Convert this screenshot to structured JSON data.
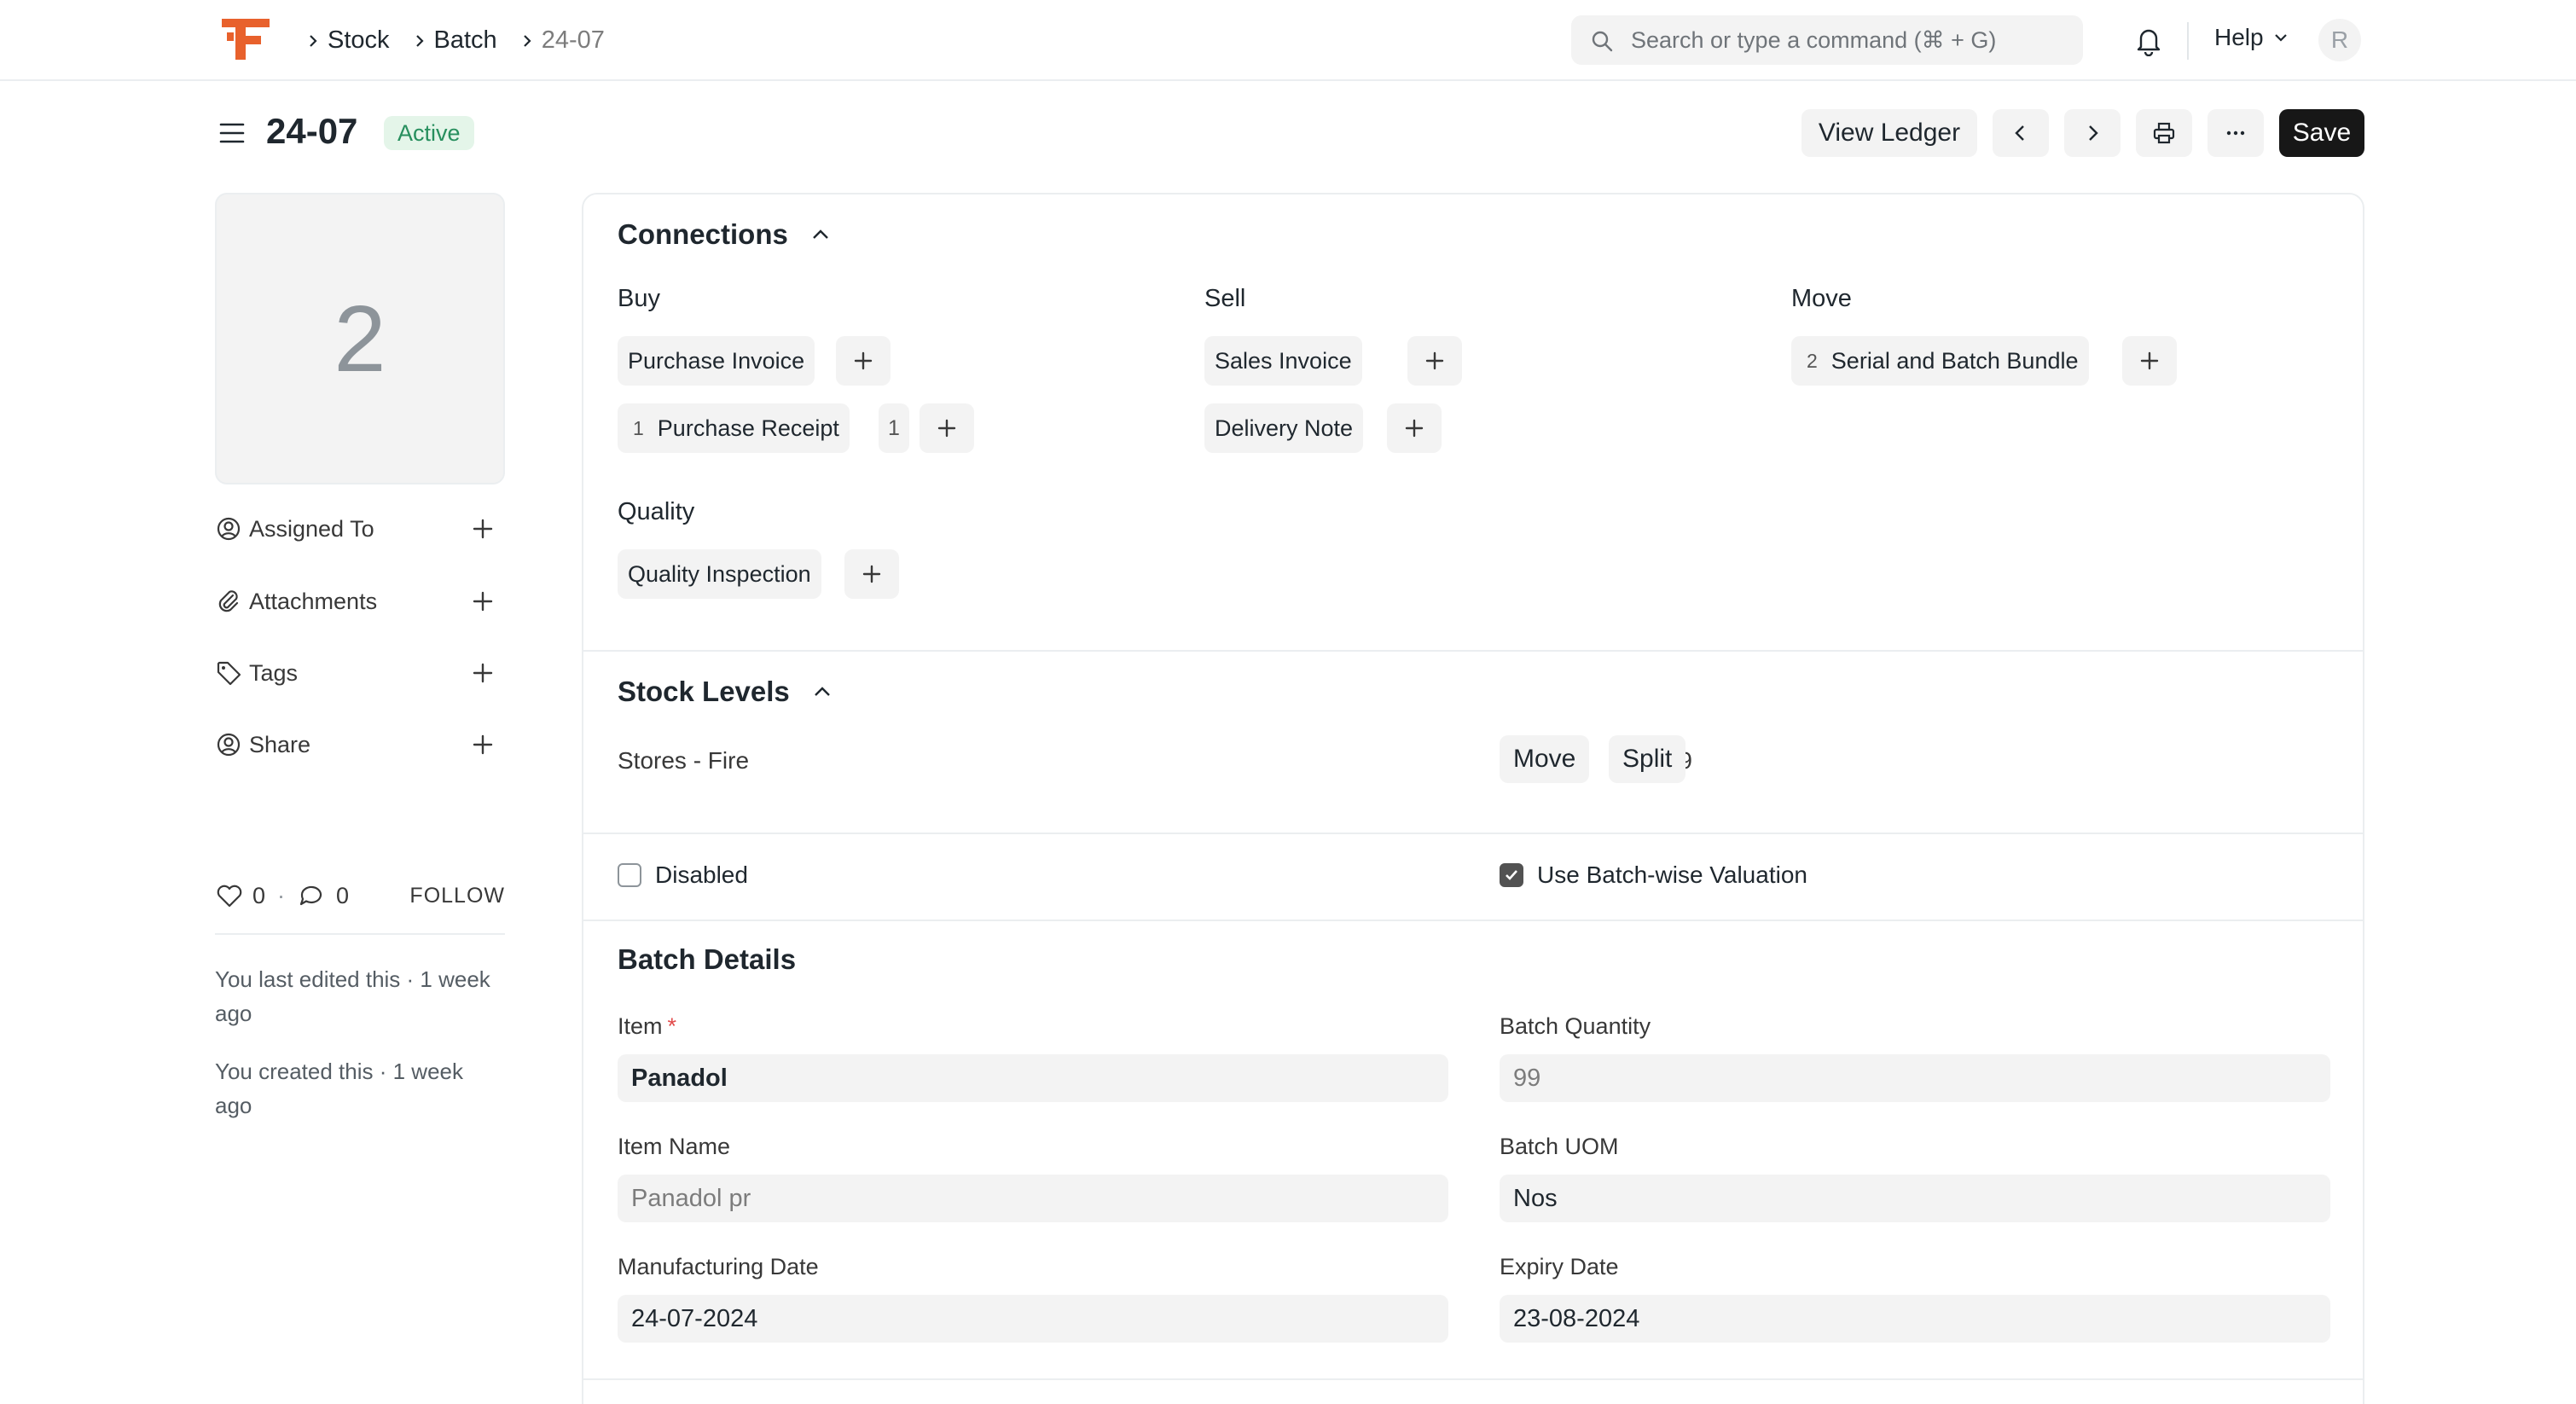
{
  "breadcrumb": {
    "items": [
      "Stock",
      "Batch",
      "24-07"
    ]
  },
  "search": {
    "placeholder": "Search or type a command (⌘ + G)"
  },
  "navbar": {
    "help_label": "Help",
    "avatar_initial": "R"
  },
  "page": {
    "title": "24-07",
    "status": "Active",
    "status_color": "#278f5e",
    "buttons": {
      "view_ledger": "View Ledger",
      "save": "Save"
    }
  },
  "sidebar": {
    "image_placeholder": "2",
    "items": [
      {
        "label": "Assigned To",
        "icon": "assign-icon"
      },
      {
        "label": "Attachments",
        "icon": "paperclip-icon"
      },
      {
        "label": "Tags",
        "icon": "tag-icon"
      },
      {
        "label": "Share",
        "icon": "share-icon"
      }
    ],
    "likes": "0",
    "comments": "0",
    "dot": "·",
    "follow": "FOLLOW",
    "timeline": [
      "You last edited this · 1 week ago",
      "You created this · 1 week ago"
    ]
  },
  "connections": {
    "title": "Connections",
    "groups": {
      "buy": {
        "label": "Buy",
        "purchase_invoice": "Purchase Invoice",
        "purchase_receipt": "Purchase Receipt",
        "purchase_receipt_count": "1",
        "purchase_receipt_open": "1"
      },
      "sell": {
        "label": "Sell",
        "sales_invoice": "Sales Invoice",
        "delivery_note": "Delivery Note"
      },
      "move": {
        "label": "Move",
        "bundle": "Serial and Batch Bundle",
        "bundle_count": "2"
      },
      "quality": {
        "label": "Quality",
        "inspection": "Quality Inspection"
      }
    }
  },
  "stock_levels": {
    "title": "Stock Levels",
    "rows": [
      {
        "warehouse": "Stores - Fire",
        "qty": "99"
      }
    ],
    "move_label": "Move",
    "split_label": "Split"
  },
  "flags": {
    "disabled": {
      "label": "Disabled",
      "checked": false
    },
    "batch_wise_valuation": {
      "label": "Use Batch-wise Valuation",
      "checked": true
    }
  },
  "batch_details": {
    "title": "Batch Details",
    "item": {
      "label": "Item",
      "required": "*",
      "value": "Panadol"
    },
    "batch_quantity": {
      "label": "Batch Quantity",
      "value": "99"
    },
    "item_name": {
      "label": "Item Name",
      "value": "Panadol pr"
    },
    "batch_uom": {
      "label": "Batch UOM",
      "value": "Nos"
    },
    "manufacturing_date": {
      "label": "Manufacturing Date",
      "value": "24-07-2024"
    },
    "expiry_date": {
      "label": "Expiry Date",
      "value": "23-08-2024"
    }
  },
  "colors": {
    "brand": "#e8612c",
    "primary_button": "#171717",
    "active_badge_bg": "#e4f5e9"
  }
}
